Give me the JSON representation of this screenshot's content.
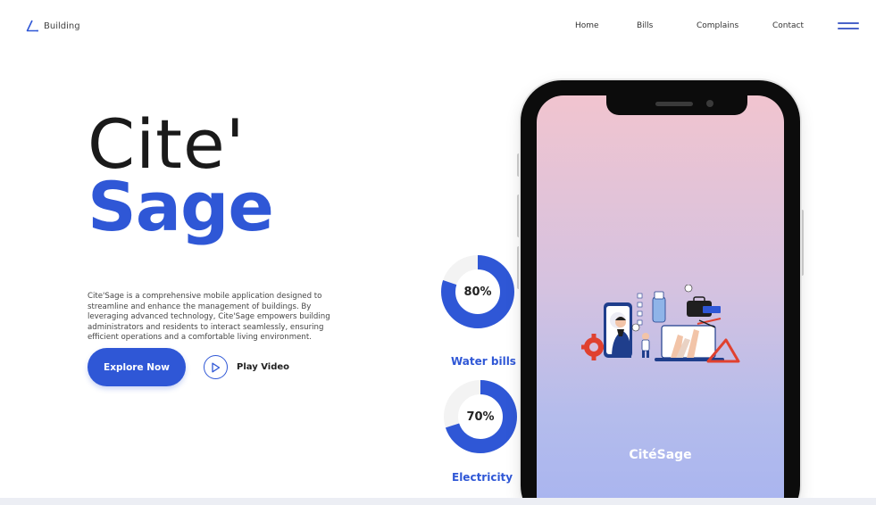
{
  "header": {
    "logo_text": "Building",
    "logo_icon": "triangle-logo-icon",
    "nav": [
      {
        "label": "Home"
      },
      {
        "label": "Bills"
      },
      {
        "label": "Complains"
      },
      {
        "label": "Contact"
      }
    ],
    "menu_icon": "hamburger-menu-icon"
  },
  "hero": {
    "title_line1": "Cite'",
    "title_line2": "Sage",
    "description": "Cite'Sage is a comprehensive mobile application designed to streamline and enhance the management of buildings. By leveraging advanced technology, Cite'Sage empowers building administrators and residents to interact seamlessly, ensuring efficient operations and a comfortable living environment.",
    "explore_label": "Explore Now",
    "play_label": "Play Video",
    "play_icon": "play-icon"
  },
  "stats": [
    {
      "label": "Water bills",
      "percent_text": "80%",
      "value": 0.8
    },
    {
      "label": "Electricity",
      "percent_text": "70%",
      "value": 0.7
    }
  ],
  "phone": {
    "app_name": "CitéSage"
  },
  "colors": {
    "accent": "#2f57d6",
    "donut_track": "#f3f3f3",
    "screen_top": "#f1c4cf",
    "screen_bottom": "#a7b3f0"
  }
}
